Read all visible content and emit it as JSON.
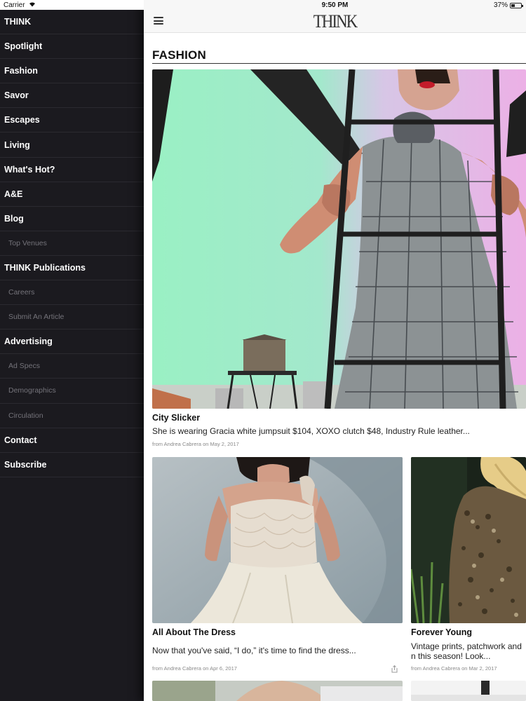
{
  "status": {
    "carrier": "Carrier",
    "time": "9:50 PM",
    "battery": "37%"
  },
  "header": {
    "logo": "THINK"
  },
  "sidebar": {
    "items": [
      {
        "label": "THINK",
        "type": "main"
      },
      {
        "label": "Spotlight",
        "type": "main"
      },
      {
        "label": "Fashion",
        "type": "main"
      },
      {
        "label": "Savor",
        "type": "main"
      },
      {
        "label": "Escapes",
        "type": "main"
      },
      {
        "label": "Living",
        "type": "main"
      },
      {
        "label": "What's Hot?",
        "type": "main"
      },
      {
        "label": "A&E",
        "type": "main"
      },
      {
        "label": "Blog",
        "type": "main"
      },
      {
        "label": "Top Venues",
        "type": "sub"
      },
      {
        "label": "THINK Publications",
        "type": "main"
      },
      {
        "label": "Careers",
        "type": "sub"
      },
      {
        "label": "Submit An Article",
        "type": "sub"
      },
      {
        "label": "Advertising",
        "type": "main"
      },
      {
        "label": "Ad Specs",
        "type": "sub"
      },
      {
        "label": "Demographics",
        "type": "sub"
      },
      {
        "label": "Circulation",
        "type": "sub"
      },
      {
        "label": "Contact",
        "type": "main"
      },
      {
        "label": "Subscribe",
        "type": "main"
      }
    ]
  },
  "main": {
    "section_title": "FASHION",
    "featured": {
      "title": "City Slicker",
      "excerpt": "She is wearing Gracia white jumpsuit $104, XOXO clutch $48, Industry Rule leather...",
      "meta": "from Andrea Cabrera on May 2, 2017"
    },
    "articles": [
      {
        "title": "All About The Dress",
        "excerpt": "Now that you've said, “I do,” it's time to find the dress...",
        "meta": "from Andrea Cabrera on Apr 6, 2017"
      },
      {
        "title": "Forever Young",
        "excerpt": "Vintage prints, patchwork and n this season! Look...",
        "meta": "from Andrea Cabrera on Mar 2, 2017"
      }
    ]
  },
  "colors": {
    "sidebar_bg": "#1b1a1f",
    "sidebar_text": "#ffffff",
    "sidebar_sub_text": "#74737a",
    "accent_text": "#111111"
  }
}
